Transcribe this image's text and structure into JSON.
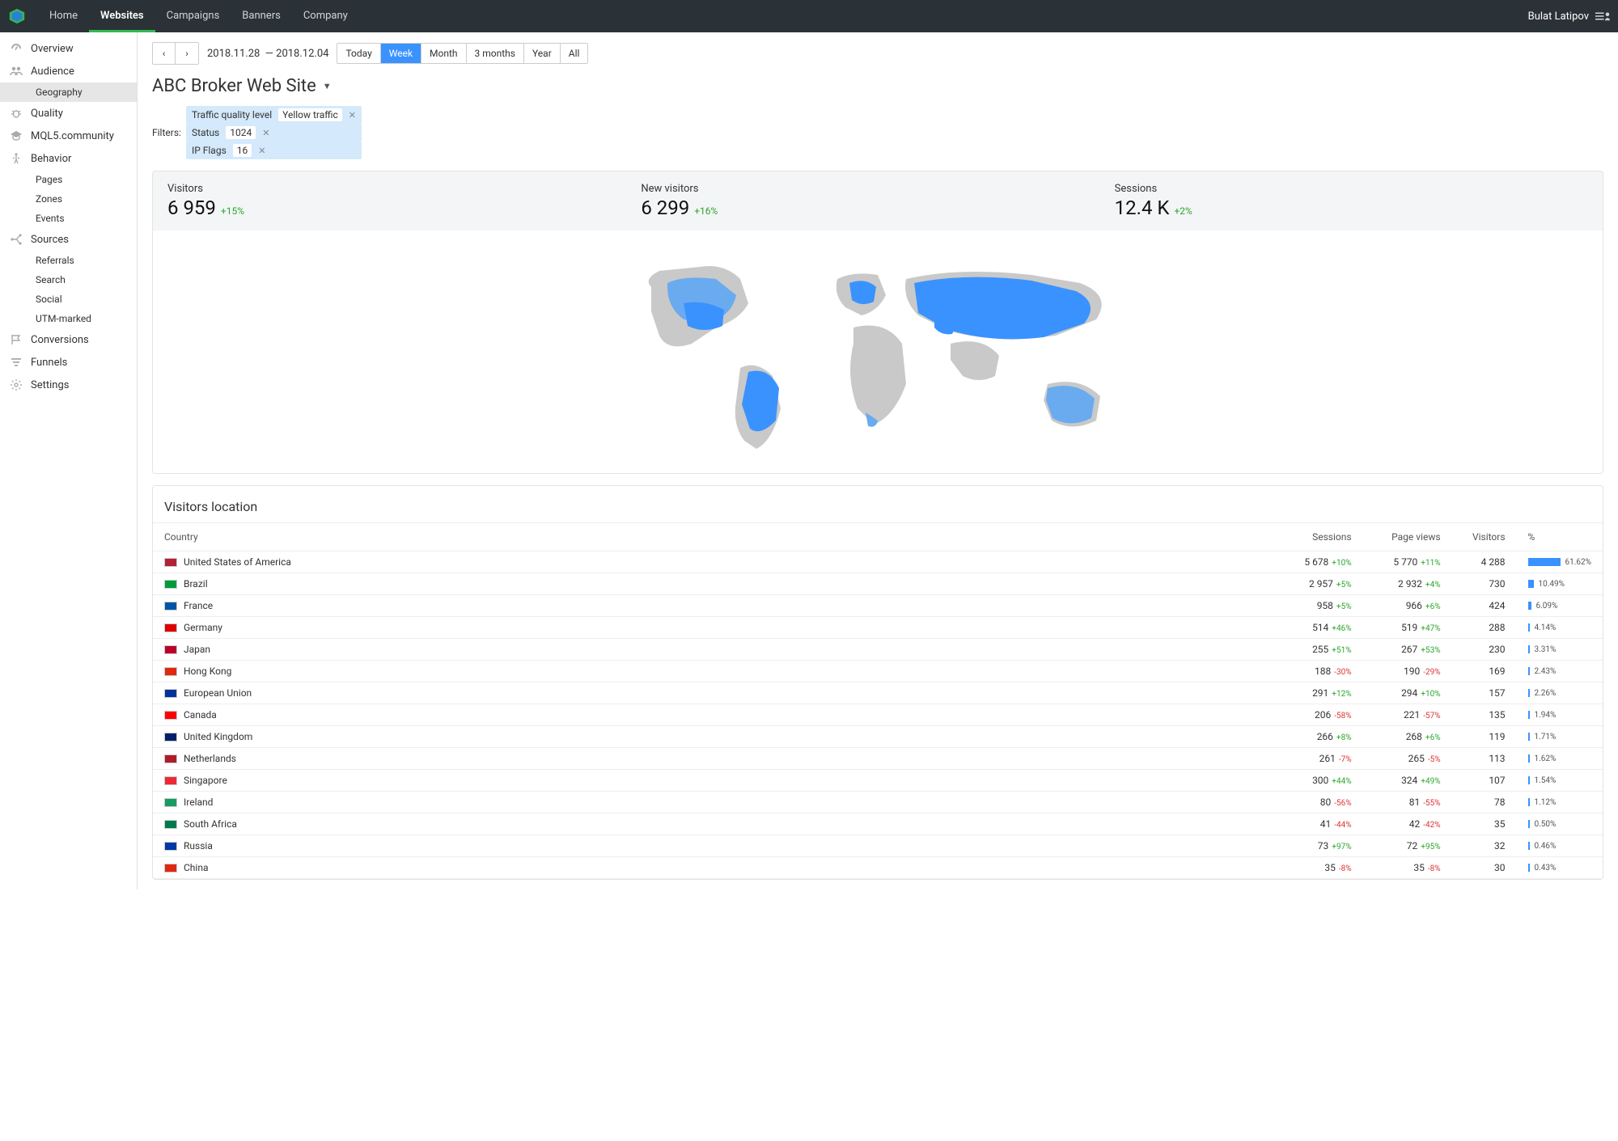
{
  "topnav": {
    "items": [
      "Home",
      "Websites",
      "Campaigns",
      "Banners",
      "Company"
    ],
    "active": "Websites",
    "user": "Bulat Latipov"
  },
  "sidebar": {
    "overview": "Overview",
    "audience": "Audience",
    "audience_sub": [
      "Geography"
    ],
    "audience_active": "Geography",
    "quality": "Quality",
    "mql5": "MQL5.community",
    "behavior": "Behavior",
    "behavior_sub": [
      "Pages",
      "Zones",
      "Events"
    ],
    "sources": "Sources",
    "sources_sub": [
      "Referrals",
      "Search",
      "Social",
      "UTM-marked"
    ],
    "conversions": "Conversions",
    "funnels": "Funnels",
    "settings": "Settings"
  },
  "toolbar": {
    "date_from": "2018.11.28",
    "date_to": "2018.12.04",
    "ranges": [
      "Today",
      "Week",
      "Month",
      "3 months",
      "Year",
      "All"
    ],
    "active_range": "Week"
  },
  "page": {
    "title": "ABC Broker Web Site"
  },
  "filters": {
    "label": "Filters:",
    "items": [
      {
        "name": "Traffic quality level",
        "value": "Yellow traffic"
      },
      {
        "name": "Status",
        "value": "1024"
      },
      {
        "name": "IP Flags",
        "value": "16"
      }
    ]
  },
  "summary": {
    "visitors_label": "Visitors",
    "visitors": "6 959",
    "visitors_delta": "+15%",
    "new_label": "New visitors",
    "new": "6 299",
    "new_delta": "+16%",
    "sessions_label": "Sessions",
    "sessions": "12.4 K",
    "sessions_delta": "+2%"
  },
  "table": {
    "title": "Visitors location",
    "cols": [
      "Country",
      "Sessions",
      "Page views",
      "Visitors",
      "%"
    ],
    "rows": [
      {
        "flag": "#b22234",
        "country": "United States of America",
        "sessions": "5 678",
        "sessions_d": "+10%",
        "pv": "5 770",
        "pv_d": "+11%",
        "visitors": "4 288",
        "pct": "61.62%",
        "bar": 61.62
      },
      {
        "flag": "#009b3a",
        "country": "Brazil",
        "sessions": "2 957",
        "sessions_d": "+5%",
        "pv": "2 932",
        "pv_d": "+4%",
        "visitors": "730",
        "pct": "10.49%",
        "bar": 10.49
      },
      {
        "flag": "#0055a4",
        "country": "France",
        "sessions": "958",
        "sessions_d": "+5%",
        "pv": "966",
        "pv_d": "+6%",
        "visitors": "424",
        "pct": "6.09%",
        "bar": 6.09
      },
      {
        "flag": "#dd0000",
        "country": "Germany",
        "sessions": "514",
        "sessions_d": "+46%",
        "pv": "519",
        "pv_d": "+47%",
        "visitors": "288",
        "pct": "4.14%",
        "bar": 4.14
      },
      {
        "flag": "#bc002d",
        "country": "Japan",
        "sessions": "255",
        "sessions_d": "+51%",
        "pv": "267",
        "pv_d": "+53%",
        "visitors": "230",
        "pct": "3.31%",
        "bar": 3.31
      },
      {
        "flag": "#de2910",
        "country": "Hong Kong",
        "sessions": "188",
        "sessions_d": "-30%",
        "pv": "190",
        "pv_d": "-29%",
        "visitors": "169",
        "pct": "2.43%",
        "bar": 2.43
      },
      {
        "flag": "#003399",
        "country": "European Union",
        "sessions": "291",
        "sessions_d": "+12%",
        "pv": "294",
        "pv_d": "+10%",
        "visitors": "157",
        "pct": "2.26%",
        "bar": 2.26
      },
      {
        "flag": "#ff0000",
        "country": "Canada",
        "sessions": "206",
        "sessions_d": "-58%",
        "pv": "221",
        "pv_d": "-57%",
        "visitors": "135",
        "pct": "1.94%",
        "bar": 1.94
      },
      {
        "flag": "#012169",
        "country": "United Kingdom",
        "sessions": "266",
        "sessions_d": "+8%",
        "pv": "268",
        "pv_d": "+6%",
        "visitors": "119",
        "pct": "1.71%",
        "bar": 1.71
      },
      {
        "flag": "#ae1c28",
        "country": "Netherlands",
        "sessions": "261",
        "sessions_d": "-7%",
        "pv": "265",
        "pv_d": "-5%",
        "visitors": "113",
        "pct": "1.62%",
        "bar": 1.62
      },
      {
        "flag": "#ed2939",
        "country": "Singapore",
        "sessions": "300",
        "sessions_d": "+44%",
        "pv": "324",
        "pv_d": "+49%",
        "visitors": "107",
        "pct": "1.54%",
        "bar": 1.54
      },
      {
        "flag": "#169b62",
        "country": "Ireland",
        "sessions": "80",
        "sessions_d": "-56%",
        "pv": "81",
        "pv_d": "-55%",
        "visitors": "78",
        "pct": "1.12%",
        "bar": 1.12
      },
      {
        "flag": "#007a4d",
        "country": "South Africa",
        "sessions": "41",
        "sessions_d": "-44%",
        "pv": "42",
        "pv_d": "-42%",
        "visitors": "35",
        "pct": "0.50%",
        "bar": 0.5
      },
      {
        "flag": "#0039a6",
        "country": "Russia",
        "sessions": "73",
        "sessions_d": "+97%",
        "pv": "72",
        "pv_d": "+95%",
        "visitors": "32",
        "pct": "0.46%",
        "bar": 0.46
      },
      {
        "flag": "#de2910",
        "country": "China",
        "sessions": "35",
        "sessions_d": "-8%",
        "pv": "35",
        "pv_d": "-8%",
        "visitors": "30",
        "pct": "0.43%",
        "bar": 0.43
      }
    ]
  }
}
